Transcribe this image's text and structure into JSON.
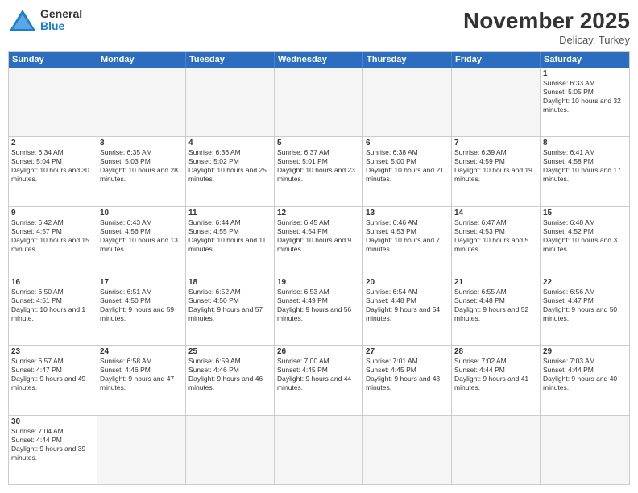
{
  "logo": {
    "general": "General",
    "blue": "Blue"
  },
  "title": "November 2025",
  "subtitle": "Delicay, Turkey",
  "days": [
    "Sunday",
    "Monday",
    "Tuesday",
    "Wednesday",
    "Thursday",
    "Friday",
    "Saturday"
  ],
  "weeks": [
    [
      {
        "day": "",
        "text": ""
      },
      {
        "day": "",
        "text": ""
      },
      {
        "day": "",
        "text": ""
      },
      {
        "day": "",
        "text": ""
      },
      {
        "day": "",
        "text": ""
      },
      {
        "day": "",
        "text": ""
      },
      {
        "day": "1",
        "text": "Sunrise: 6:33 AM\nSunset: 5:05 PM\nDaylight: 10 hours and 32 minutes."
      }
    ],
    [
      {
        "day": "2",
        "text": "Sunrise: 6:34 AM\nSunset: 5:04 PM\nDaylight: 10 hours and 30 minutes."
      },
      {
        "day": "3",
        "text": "Sunrise: 6:35 AM\nSunset: 5:03 PM\nDaylight: 10 hours and 28 minutes."
      },
      {
        "day": "4",
        "text": "Sunrise: 6:36 AM\nSunset: 5:02 PM\nDaylight: 10 hours and 25 minutes."
      },
      {
        "day": "5",
        "text": "Sunrise: 6:37 AM\nSunset: 5:01 PM\nDaylight: 10 hours and 23 minutes."
      },
      {
        "day": "6",
        "text": "Sunrise: 6:38 AM\nSunset: 5:00 PM\nDaylight: 10 hours and 21 minutes."
      },
      {
        "day": "7",
        "text": "Sunrise: 6:39 AM\nSunset: 4:59 PM\nDaylight: 10 hours and 19 minutes."
      },
      {
        "day": "8",
        "text": "Sunrise: 6:41 AM\nSunset: 4:58 PM\nDaylight: 10 hours and 17 minutes."
      }
    ],
    [
      {
        "day": "9",
        "text": "Sunrise: 6:42 AM\nSunset: 4:57 PM\nDaylight: 10 hours and 15 minutes."
      },
      {
        "day": "10",
        "text": "Sunrise: 6:43 AM\nSunset: 4:56 PM\nDaylight: 10 hours and 13 minutes."
      },
      {
        "day": "11",
        "text": "Sunrise: 6:44 AM\nSunset: 4:55 PM\nDaylight: 10 hours and 11 minutes."
      },
      {
        "day": "12",
        "text": "Sunrise: 6:45 AM\nSunset: 4:54 PM\nDaylight: 10 hours and 9 minutes."
      },
      {
        "day": "13",
        "text": "Sunrise: 6:46 AM\nSunset: 4:53 PM\nDaylight: 10 hours and 7 minutes."
      },
      {
        "day": "14",
        "text": "Sunrise: 6:47 AM\nSunset: 4:53 PM\nDaylight: 10 hours and 5 minutes."
      },
      {
        "day": "15",
        "text": "Sunrise: 6:48 AM\nSunset: 4:52 PM\nDaylight: 10 hours and 3 minutes."
      }
    ],
    [
      {
        "day": "16",
        "text": "Sunrise: 6:50 AM\nSunset: 4:51 PM\nDaylight: 10 hours and 1 minute."
      },
      {
        "day": "17",
        "text": "Sunrise: 6:51 AM\nSunset: 4:50 PM\nDaylight: 9 hours and 59 minutes."
      },
      {
        "day": "18",
        "text": "Sunrise: 6:52 AM\nSunset: 4:50 PM\nDaylight: 9 hours and 57 minutes."
      },
      {
        "day": "19",
        "text": "Sunrise: 6:53 AM\nSunset: 4:49 PM\nDaylight: 9 hours and 56 minutes."
      },
      {
        "day": "20",
        "text": "Sunrise: 6:54 AM\nSunset: 4:48 PM\nDaylight: 9 hours and 54 minutes."
      },
      {
        "day": "21",
        "text": "Sunrise: 6:55 AM\nSunset: 4:48 PM\nDaylight: 9 hours and 52 minutes."
      },
      {
        "day": "22",
        "text": "Sunrise: 6:56 AM\nSunset: 4:47 PM\nDaylight: 9 hours and 50 minutes."
      }
    ],
    [
      {
        "day": "23",
        "text": "Sunrise: 6:57 AM\nSunset: 4:47 PM\nDaylight: 9 hours and 49 minutes."
      },
      {
        "day": "24",
        "text": "Sunrise: 6:58 AM\nSunset: 4:46 PM\nDaylight: 9 hours and 47 minutes."
      },
      {
        "day": "25",
        "text": "Sunrise: 6:59 AM\nSunset: 4:46 PM\nDaylight: 9 hours and 46 minutes."
      },
      {
        "day": "26",
        "text": "Sunrise: 7:00 AM\nSunset: 4:45 PM\nDaylight: 9 hours and 44 minutes."
      },
      {
        "day": "27",
        "text": "Sunrise: 7:01 AM\nSunset: 4:45 PM\nDaylight: 9 hours and 43 minutes."
      },
      {
        "day": "28",
        "text": "Sunrise: 7:02 AM\nSunset: 4:44 PM\nDaylight: 9 hours and 41 minutes."
      },
      {
        "day": "29",
        "text": "Sunrise: 7:03 AM\nSunset: 4:44 PM\nDaylight: 9 hours and 40 minutes."
      }
    ],
    [
      {
        "day": "30",
        "text": "Sunrise: 7:04 AM\nSunset: 4:44 PM\nDaylight: 9 hours and 39 minutes."
      },
      {
        "day": "",
        "text": ""
      },
      {
        "day": "",
        "text": ""
      },
      {
        "day": "",
        "text": ""
      },
      {
        "day": "",
        "text": ""
      },
      {
        "day": "",
        "text": ""
      },
      {
        "day": "",
        "text": ""
      }
    ]
  ]
}
